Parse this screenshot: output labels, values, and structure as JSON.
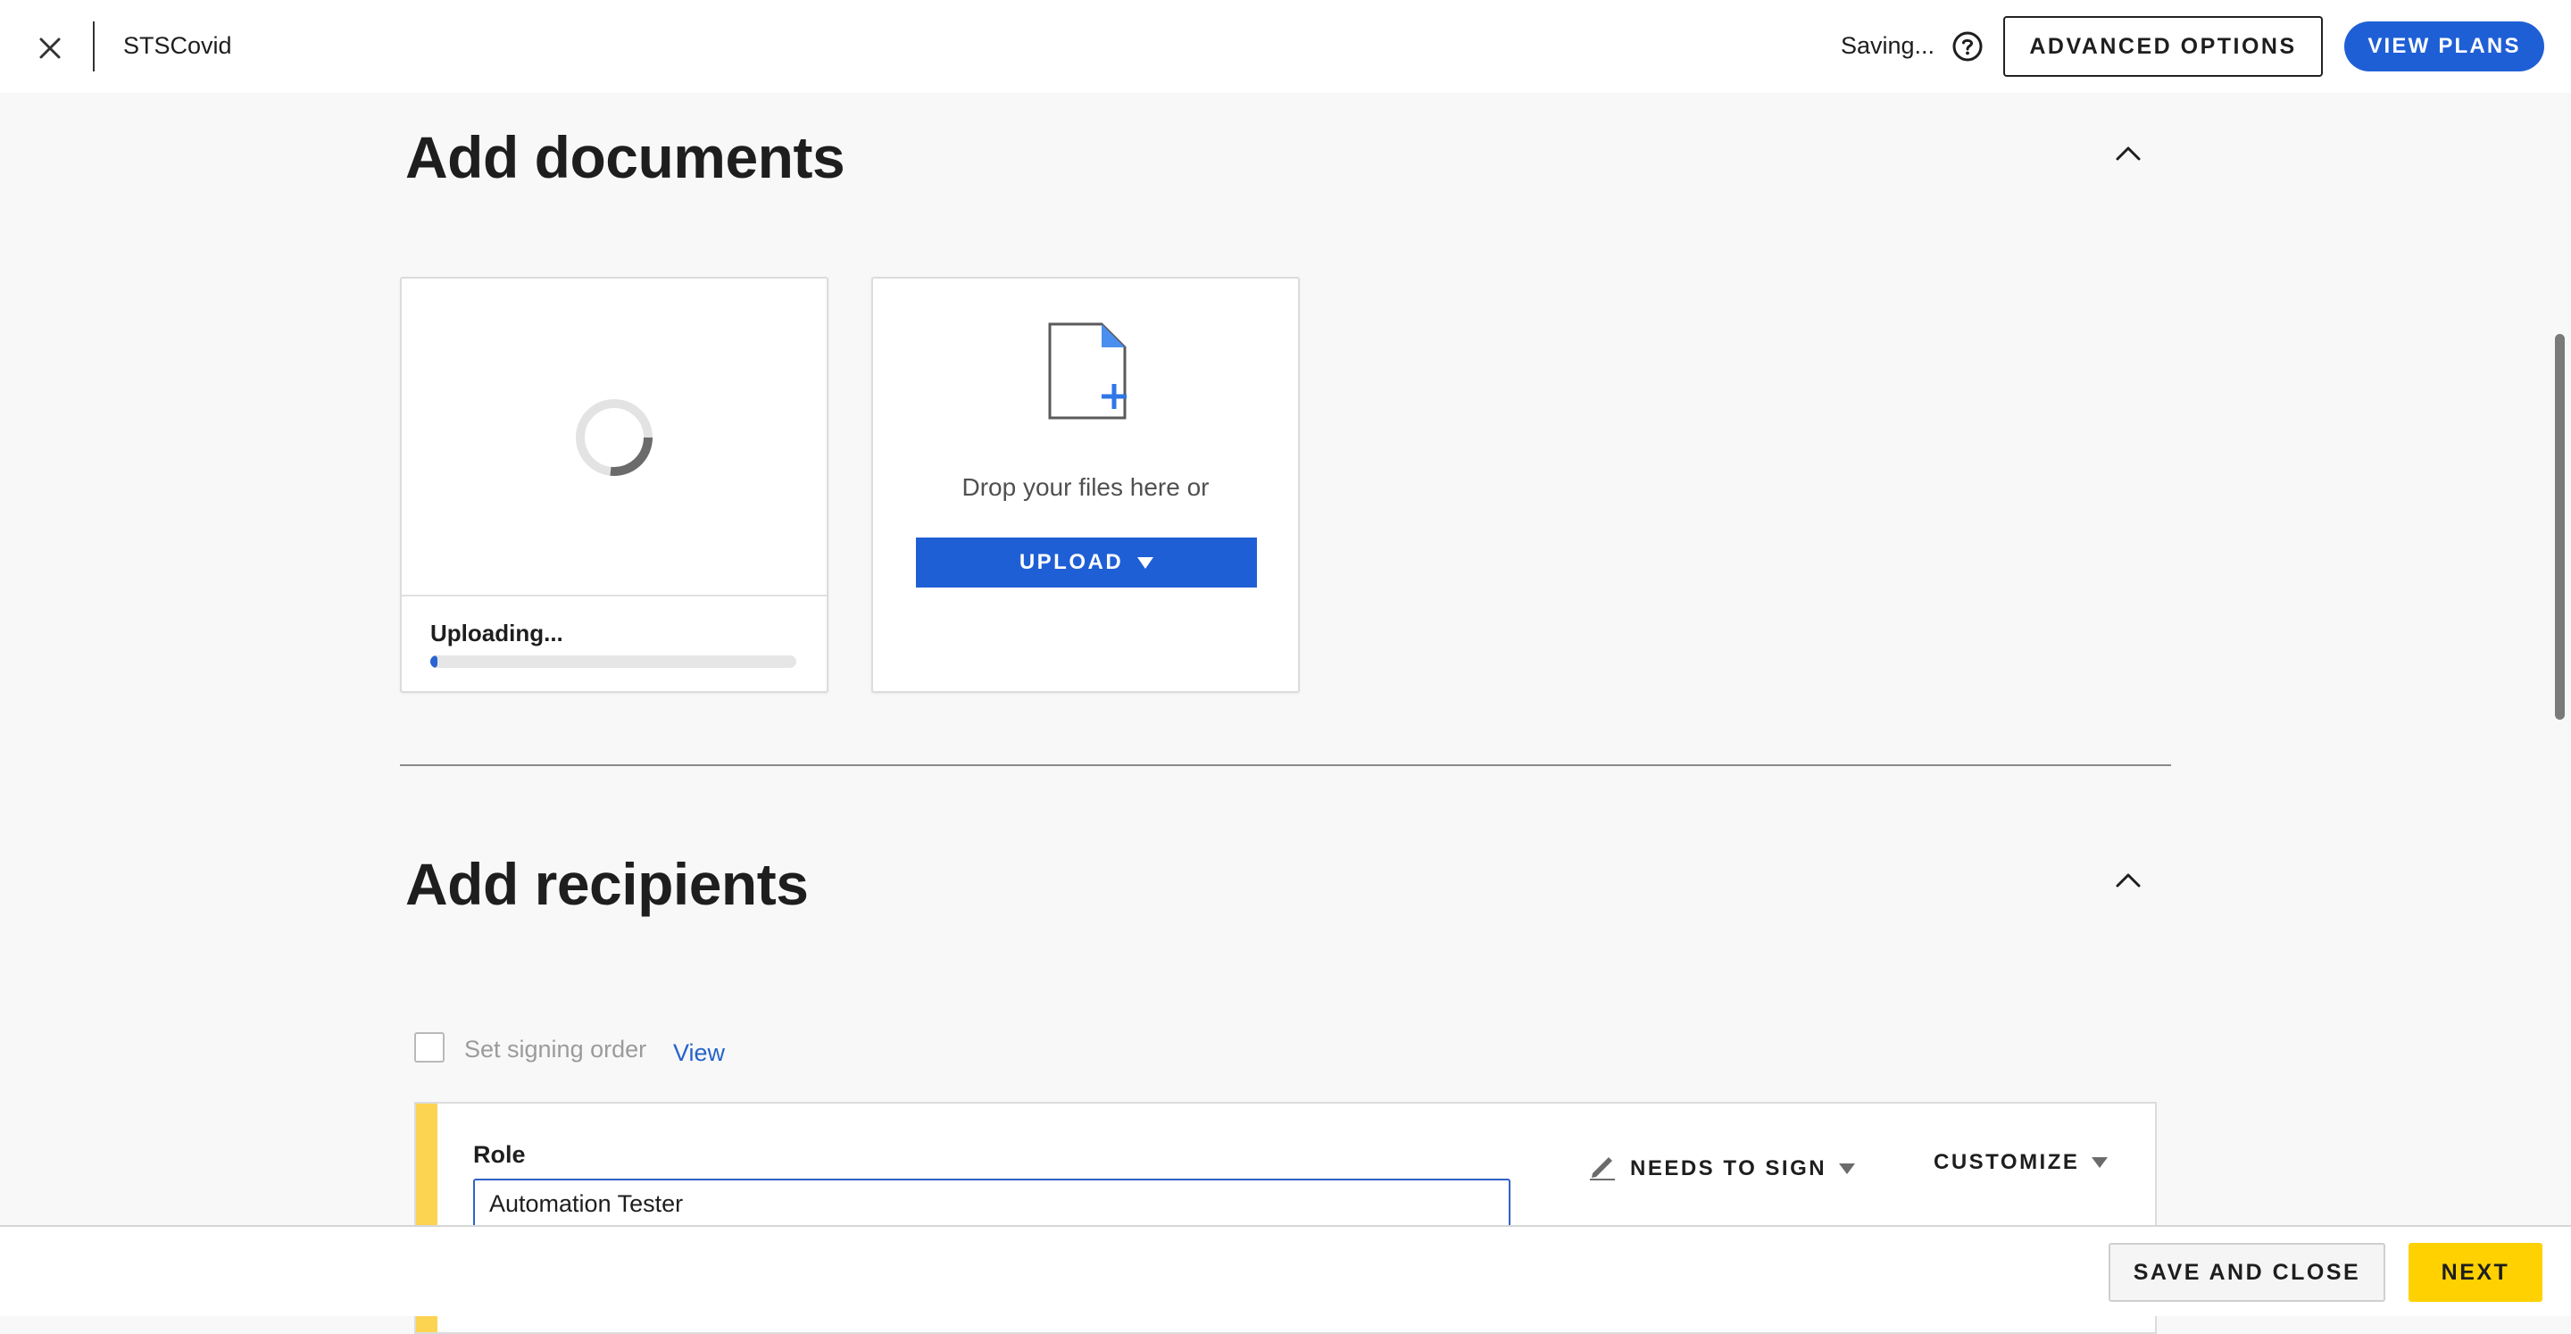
{
  "header": {
    "title": "STSCovid",
    "status": "Saving...",
    "advanced_options": "ADVANCED OPTIONS",
    "view_plans": "VIEW PLANS"
  },
  "documents": {
    "title": "Add documents",
    "upload_card": {
      "status": "Uploading...",
      "progress_percent": 2
    },
    "drop_card": {
      "text": "Drop your files here or",
      "upload_label": "UPLOAD"
    }
  },
  "recipients": {
    "title": "Add recipients",
    "signing_order_label": "Set signing order",
    "signing_order_checked": false,
    "view_link": "View",
    "recipient": {
      "role_label": "Role",
      "role_value": "Automation Tester",
      "action_label": "NEEDS TO SIGN",
      "customize_label": "CUSTOMIZE"
    }
  },
  "footer": {
    "save_close": "SAVE AND CLOSE",
    "next": "NEXT"
  },
  "colors": {
    "primary": "#1f5fd6",
    "accent_yellow": "#ffd100",
    "recipient_strip": "#fdd352"
  }
}
